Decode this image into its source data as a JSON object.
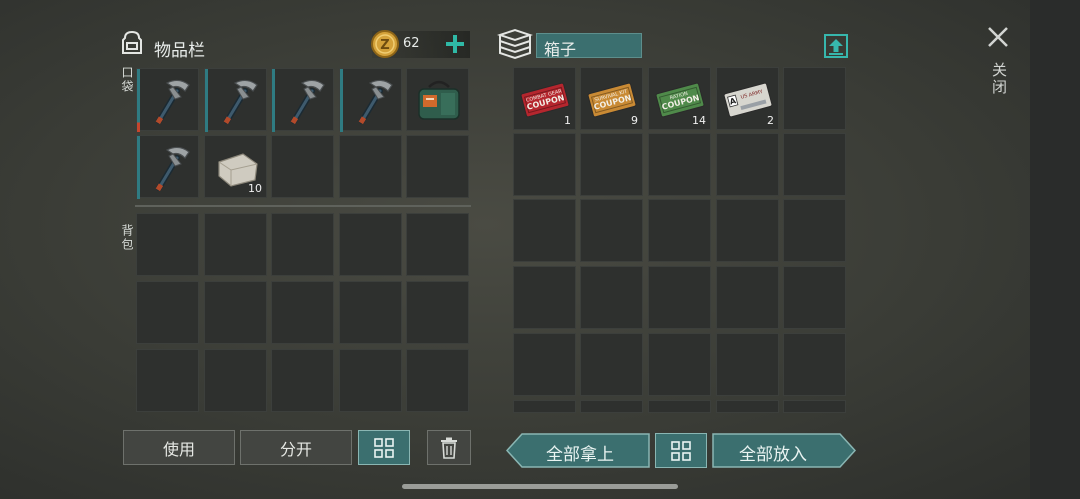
{
  "inventory": {
    "title": "物品栏",
    "coins": "62",
    "pocket_label": "口袋",
    "backpack_label": "背包"
  },
  "container": {
    "title": "箱子"
  },
  "close": {
    "label": "关闭"
  },
  "pocket_items": [
    {
      "name": "hatchet",
      "count": ""
    },
    {
      "name": "hatchet",
      "count": ""
    },
    {
      "name": "hatchet",
      "count": ""
    },
    {
      "name": "hatchet",
      "count": ""
    },
    {
      "name": "green-bag",
      "count": ""
    },
    {
      "name": "hatchet",
      "count": ""
    },
    {
      "name": "stone-block",
      "count": "10"
    }
  ],
  "box_items": [
    {
      "name": "combat-gear-coupon",
      "label_top": "COMBAT GEAR",
      "label_main": "COUPON",
      "count": "1",
      "color": "#b5262e"
    },
    {
      "name": "survival-coupon",
      "label_top": "SURVIVAL KIT",
      "label_main": "COUPON",
      "count": "9",
      "color": "#c98a34"
    },
    {
      "name": "ration-coupon",
      "label_top": "RATION",
      "label_main": "COUPON",
      "count": "14",
      "color": "#4f8a4a"
    },
    {
      "name": "us-army-card",
      "label_top": "US ARMY",
      "label_main": "A",
      "count": "2",
      "color": "#d7d6cf"
    }
  ],
  "buttons": {
    "use": "使用",
    "split": "分开",
    "take_all": "全部拿上",
    "put_all": "全部放入"
  },
  "colors": {
    "teal": "#3b6f6f",
    "slot": "#2e302e",
    "durability": "#2f7b82",
    "coin": "#d4a23a"
  }
}
